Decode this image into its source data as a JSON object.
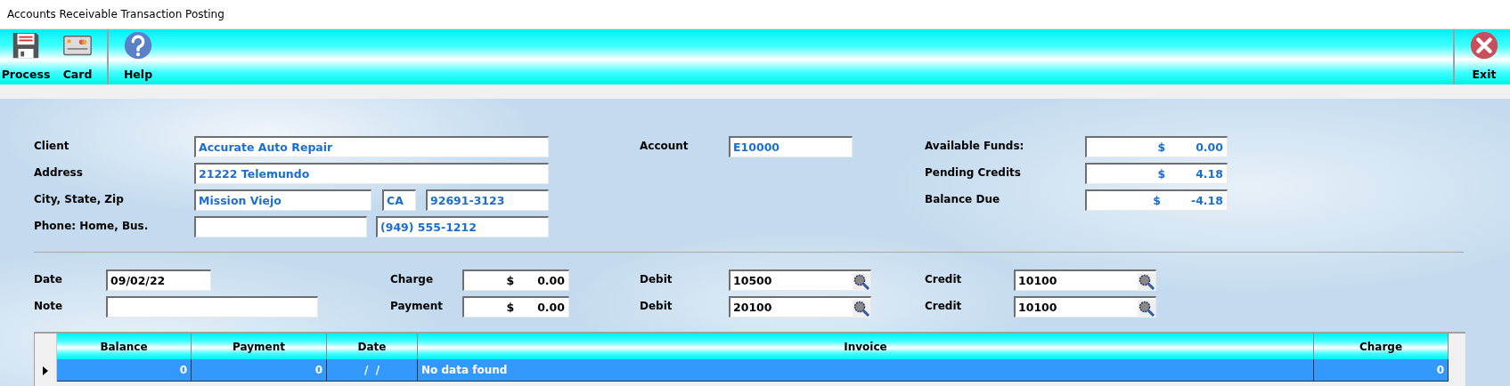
{
  "window": {
    "title": "Accounts Receivable Transaction Posting"
  },
  "toolbar": {
    "left": [
      {
        "label": "Process",
        "kind": "save"
      },
      {
        "label": "Card",
        "kind": "card"
      },
      {
        "label": "Help",
        "kind": "help",
        "separator_before": true
      }
    ],
    "right": [
      {
        "label": "Exit",
        "kind": "exit",
        "separator_before": true
      }
    ]
  },
  "client": [
    {
      "label": "Client",
      "inputs": [
        {
          "kind": "text",
          "value": "Accurate Auto Repair"
        }
      ]
    },
    {
      "label": "Address",
      "inputs": [
        {
          "kind": "text",
          "value": "21222 Telemundo"
        }
      ]
    },
    {
      "label": "City, State, Zip",
      "inputs": [
        {
          "kind": "text",
          "value": "Mission Viejo"
        },
        {
          "kind": "text",
          "value": "CA"
        },
        {
          "kind": "text",
          "value": "92691-3123"
        }
      ]
    },
    {
      "label": "Phone: Home, Bus.",
      "inputs": [
        {
          "kind": "text"
        },
        {
          "kind": "text",
          "value": "(949) 555-1212"
        }
      ]
    }
  ],
  "account": {
    "label": "Account",
    "value": "E10000"
  },
  "balances": [
    {
      "label": "Available Funds:",
      "currency": "$",
      "amount": "0.00"
    },
    {
      "label": "Pending Credits",
      "currency": "$",
      "amount": "4.18"
    },
    {
      "label": "Balance Due",
      "currency": "$",
      "amount": "-4.18"
    }
  ],
  "posting": {
    "fields": [
      {
        "label": "Date",
        "value": "09/02/22"
      },
      {
        "label": "Note"
      }
    ],
    "amounts": [
      {
        "label": "Charge",
        "currency": "$",
        "amount": "0.00"
      },
      {
        "label": "Payment",
        "currency": "$",
        "amount": "0.00"
      }
    ],
    "debits": [
      {
        "label": "Debit",
        "value": "10500"
      },
      {
        "label": "Debit",
        "value": "20100"
      }
    ],
    "credits": [
      {
        "label": "Credit",
        "value": "10100"
      },
      {
        "label": "Credit",
        "value": "10100"
      }
    ]
  },
  "grid": {
    "columns": [
      {
        "label": "Balance"
      },
      {
        "label": "Payment"
      },
      {
        "label": "Date"
      },
      {
        "label": "Invoice"
      },
      {
        "label": "Charge"
      }
    ],
    "rows": [
      {
        "selected": true,
        "cells": [
          "0",
          "0",
          "/  /",
          "No data found",
          "0"
        ]
      }
    ]
  }
}
